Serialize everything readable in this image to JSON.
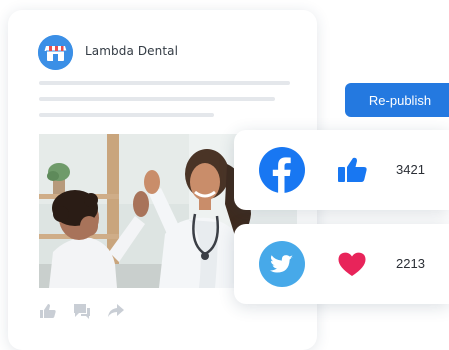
{
  "post": {
    "account_name": "Lambda Dental",
    "avatar_icon": "storefront-icon",
    "photo_subject": "dentist-high-five-child-photo",
    "actions": [
      {
        "icon": "thumbs-up-icon"
      },
      {
        "icon": "comment-icon"
      },
      {
        "icon": "share-icon"
      }
    ]
  },
  "republish": {
    "label": "Re-publish"
  },
  "social_stats": [
    {
      "network": "facebook",
      "logo_icon": "facebook-icon",
      "reaction_icon": "thumbs-up-icon",
      "count": "3421"
    },
    {
      "network": "twitter",
      "logo_icon": "twitter-icon",
      "reaction_icon": "heart-icon",
      "count": "2213"
    }
  ],
  "colors": {
    "accent": "#2479e0",
    "facebook": "#1877f2",
    "twitter": "#47a9e9",
    "heart": "#e8245a",
    "avatar": "#3b8fe6"
  }
}
